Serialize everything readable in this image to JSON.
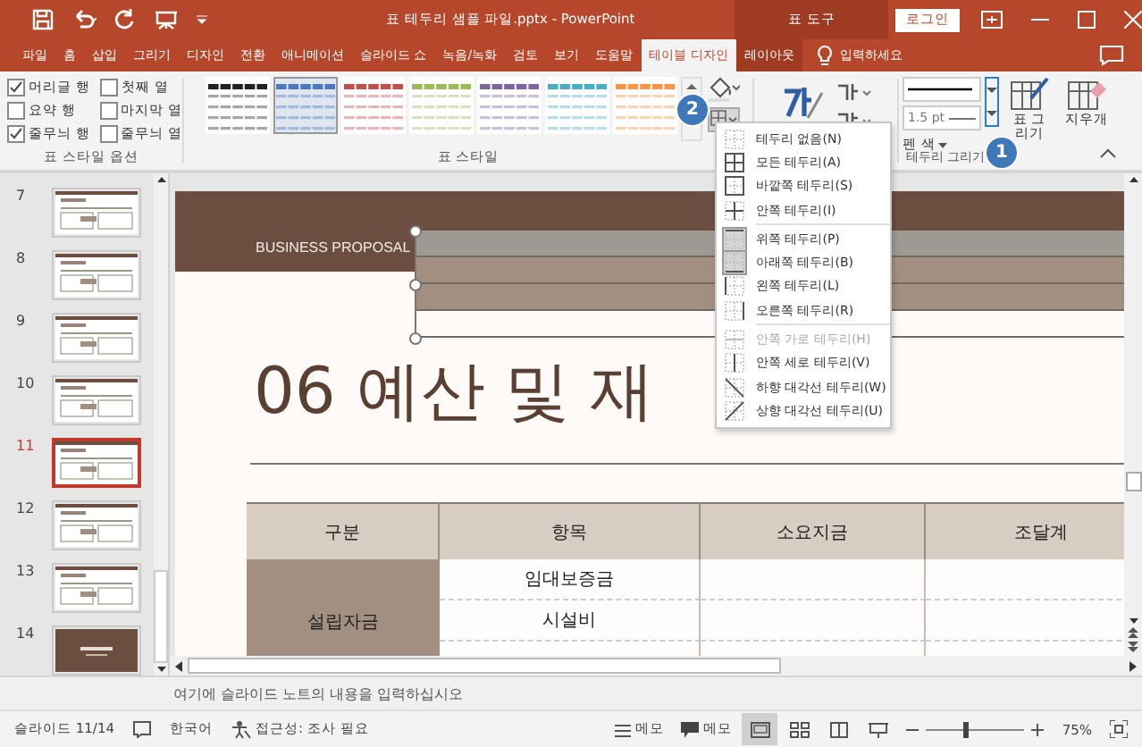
{
  "window": {
    "title": "표 테두리 샘플 파일.pptx - PowerPoint",
    "context_tab": "표 도구",
    "login": "로그인"
  },
  "tabs": [
    {
      "label": "파일",
      "selected": false
    },
    {
      "label": "홈",
      "selected": false
    },
    {
      "label": "삽입",
      "selected": false
    },
    {
      "label": "그리기",
      "selected": false
    },
    {
      "label": "디자인",
      "selected": false
    },
    {
      "label": "전환",
      "selected": false
    },
    {
      "label": "애니메이션",
      "selected": false
    },
    {
      "label": "슬라이드 쇼",
      "selected": false
    },
    {
      "label": "녹음/녹화",
      "selected": false
    },
    {
      "label": "검토",
      "selected": false
    },
    {
      "label": "보기",
      "selected": false
    },
    {
      "label": "도움말",
      "selected": false
    },
    {
      "label": "테이블 디자인",
      "selected": true
    },
    {
      "label": "레이아웃",
      "selected": false
    }
  ],
  "tell_me": "입력하세요",
  "style_options": {
    "group_label": "표 스타일 옵션",
    "items": [
      {
        "label": "머리글 행",
        "checked": true
      },
      {
        "label": "첫째 열",
        "checked": false
      },
      {
        "label": "요약 행",
        "checked": false
      },
      {
        "label": "마지막 열",
        "checked": false
      },
      {
        "label": "줄무늬 행",
        "checked": true
      },
      {
        "label": "줄무늬 열",
        "checked": false
      }
    ]
  },
  "table_styles": {
    "group_label": "표 스타일",
    "items": [
      {
        "color": "#222222",
        "selected": false
      },
      {
        "color": "#4a79c0",
        "selected": true
      },
      {
        "color": "#c0504d",
        "selected": false
      },
      {
        "color": "#9bbb59",
        "selected": false
      },
      {
        "color": "#8064a2",
        "selected": false
      },
      {
        "color": "#4bacc6",
        "selected": false
      },
      {
        "color": "#f79646",
        "selected": false
      }
    ]
  },
  "borders": {
    "group_label": "테두리 그리기",
    "pen_weight": "1.5 pt",
    "pen_color": "펜 색",
    "draw_table": "표 그리기",
    "eraser": "지우개"
  },
  "callouts": [
    {
      "number": "2"
    },
    {
      "number": "1"
    }
  ],
  "border_menu": {
    "groups": [
      [
        {
          "label": "테두리 없음(N)",
          "kind": "none",
          "selected": false,
          "disabled": false
        },
        {
          "label": "모든 테두리(A)",
          "kind": "all",
          "selected": false,
          "disabled": false
        },
        {
          "label": "바깥쪽 테두리(S)",
          "kind": "outside",
          "selected": false,
          "disabled": false
        },
        {
          "label": "안쪽 테두리(I)",
          "kind": "inside",
          "selected": false,
          "disabled": false
        }
      ],
      [
        {
          "label": "위쪽 테두리(P)",
          "kind": "top",
          "selected": true,
          "disabled": false
        },
        {
          "label": "아래쪽 테두리(B)",
          "kind": "bottom",
          "selected": true,
          "disabled": false
        },
        {
          "label": "왼쪽 테두리(L)",
          "kind": "left",
          "selected": false,
          "disabled": false
        },
        {
          "label": "오른쪽 테두리(R)",
          "kind": "right",
          "selected": false,
          "disabled": false
        }
      ],
      [
        {
          "label": "안쪽 가로 테두리(H)",
          "kind": "inside-h",
          "selected": false,
          "disabled": true
        },
        {
          "label": "안쪽 세로 테두리(V)",
          "kind": "inside-v",
          "selected": false,
          "disabled": false
        },
        {
          "label": "하향 대각선 테두리(W)",
          "kind": "diag-down",
          "selected": false,
          "disabled": false
        },
        {
          "label": "상향 대각선 테두리(U)",
          "kind": "diag-up",
          "selected": false,
          "disabled": false
        }
      ]
    ]
  },
  "thumbnails": [
    {
      "number": "7",
      "kind": "light",
      "selected": false
    },
    {
      "number": "8",
      "kind": "light",
      "selected": false
    },
    {
      "number": "9",
      "kind": "light",
      "selected": false
    },
    {
      "number": "10",
      "kind": "light",
      "selected": false
    },
    {
      "number": "11",
      "kind": "light",
      "selected": true
    },
    {
      "number": "12",
      "kind": "light",
      "selected": false
    },
    {
      "number": "13",
      "kind": "light",
      "selected": false
    },
    {
      "number": "14",
      "kind": "dark",
      "selected": false
    }
  ],
  "slide": {
    "header": "BUSINESS PROPOSAL",
    "title": "06 예산 및 재",
    "table": {
      "columns": [
        "구분",
        "항목",
        "소요지금",
        "조달계"
      ],
      "group": "설립자금",
      "items": [
        "임대보증금",
        "시설비"
      ]
    }
  },
  "notes_placeholder": "여기에 슬라이드 노트의 내용을 입력하십시오",
  "status_bar": {
    "slide": "슬라이드 11/14",
    "language": "한국어",
    "accessibility": "접근성: 조사 필요",
    "notes": "메모",
    "comments": "메모",
    "zoom": "75%",
    "level": 0.38,
    "views": [
      {
        "kind": "normal",
        "selected": true
      },
      {
        "kind": "sorter",
        "selected": false
      },
      {
        "kind": "reading",
        "selected": false
      },
      {
        "kind": "show",
        "selected": false
      }
    ]
  }
}
